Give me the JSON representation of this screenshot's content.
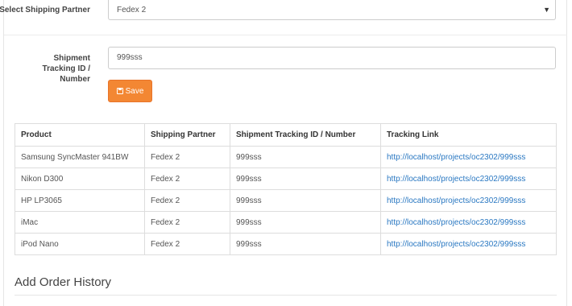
{
  "shipping": {
    "partner_label": "Select Shipping Partner",
    "partner_value": "Fedex 2",
    "tracking_label": "Shipment Tracking ID / Number",
    "tracking_value": "999sss",
    "save_label": "Save"
  },
  "table": {
    "headers": [
      "Product",
      "Shipping Partner",
      "Shipment Tracking ID / Number",
      "Tracking Link"
    ],
    "rows": [
      [
        "Samsung SyncMaster 941BW",
        "Fedex 2",
        "999sss",
        "http://localhost/projects/oc2302/999sss"
      ],
      [
        "Nikon D300",
        "Fedex 2",
        "999sss",
        "http://localhost/projects/oc2302/999sss"
      ],
      [
        "HP LP3065",
        "Fedex 2",
        "999sss",
        "http://localhost/projects/oc2302/999sss"
      ],
      [
        "iMac",
        "Fedex 2",
        "999sss",
        "http://localhost/projects/oc2302/999sss"
      ],
      [
        "iPod Nano",
        "Fedex 2",
        "999sss",
        "http://localhost/projects/oc2302/999sss"
      ]
    ]
  },
  "history": {
    "title": "Add Order History"
  },
  "colors": {
    "accent": "#f38733",
    "link": "#2a78c2"
  },
  "icons": {
    "save": "floppy-disk-icon",
    "dropdown": "caret-down-icon"
  }
}
